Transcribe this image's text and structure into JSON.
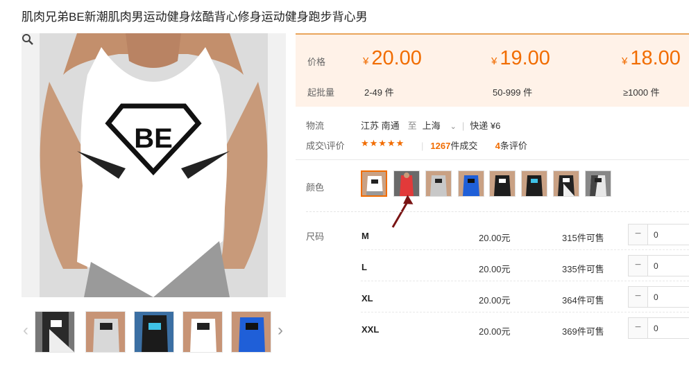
{
  "product": {
    "title": "肌肉兄弟BE新潮肌肉男运动健身炫酷背心修身运动健身跑步背心男"
  },
  "price_box": {
    "price_label": "价格",
    "qty_label": "起批量",
    "tiers": [
      {
        "currency": "¥",
        "price": "20.00",
        "qty": "2-49 件"
      },
      {
        "currency": "¥",
        "price": "19.00",
        "qty": "50-999 件"
      },
      {
        "currency": "¥",
        "price": "18.00",
        "qty": "≥1000 件"
      }
    ]
  },
  "logistics": {
    "label": "物流",
    "from": "江苏 南通",
    "to_word": "至",
    "to": "上海",
    "shipping": "快递 ¥6"
  },
  "deals": {
    "label": "成交\\评价",
    "stars": "★★★★★",
    "count": "1267",
    "count_suffix": "件成交",
    "reviews": "4",
    "reviews_suffix": "条评价"
  },
  "colors": {
    "label": "颜色"
  },
  "sizes": {
    "label": "尺码",
    "rows": [
      {
        "size": "M",
        "price": "20.00元",
        "stock": "315件可售",
        "qty": "0"
      },
      {
        "size": "L",
        "price": "20.00元",
        "stock": "335件可售",
        "qty": "0"
      },
      {
        "size": "XL",
        "price": "20.00元",
        "stock": "364件可售",
        "qty": "0"
      },
      {
        "size": "XXL",
        "price": "20.00元",
        "stock": "369件可售",
        "qty": "0"
      }
    ],
    "minus_glyph": "−"
  },
  "thumb_nav": {
    "prev": "‹",
    "next": "›"
  },
  "theme": {
    "accent": "#f16c00",
    "price_bg": "#fff2e8",
    "arrow": "#7a1414"
  }
}
